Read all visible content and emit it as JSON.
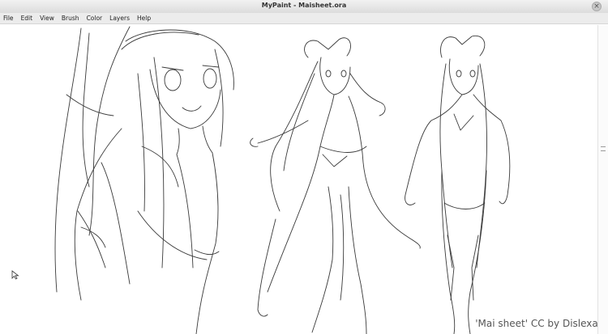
{
  "window": {
    "title": "MyPaint - Maisheet.ora"
  },
  "menu": [
    "File",
    "Edit",
    "View",
    "Brush",
    "Color",
    "Layers",
    "Help"
  ],
  "canvas": {
    "credit": "'Mai sheet' CC by Dislexas"
  },
  "icons": {
    "close": "close-icon",
    "cursor": "arrow-cursor-icon",
    "panel_handle": "panel-grip-icon"
  }
}
